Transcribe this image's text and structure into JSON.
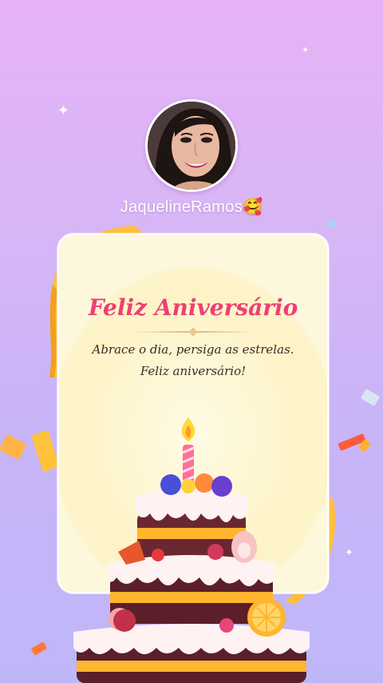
{
  "profile": {
    "username": "JaquelineRamos",
    "username_emoji": "🥰",
    "avatar_icon": "user-avatar-photo"
  },
  "card": {
    "title": "Feliz Aniversário",
    "message": "Abrace o dia, persiga as estrelas. Feliz aniversário!",
    "title_color": "#ee3f73",
    "background_color": "#fdf7dc"
  },
  "decorations": {
    "cake_icon": "birthday-cake-icon",
    "candle_icon": "candle-icon",
    "sparkle_glyph": "✦"
  },
  "colors": {
    "background_top": "#e6b2f5",
    "background_bottom": "#bfb6f8",
    "ribbon": "#ffbf3a"
  }
}
